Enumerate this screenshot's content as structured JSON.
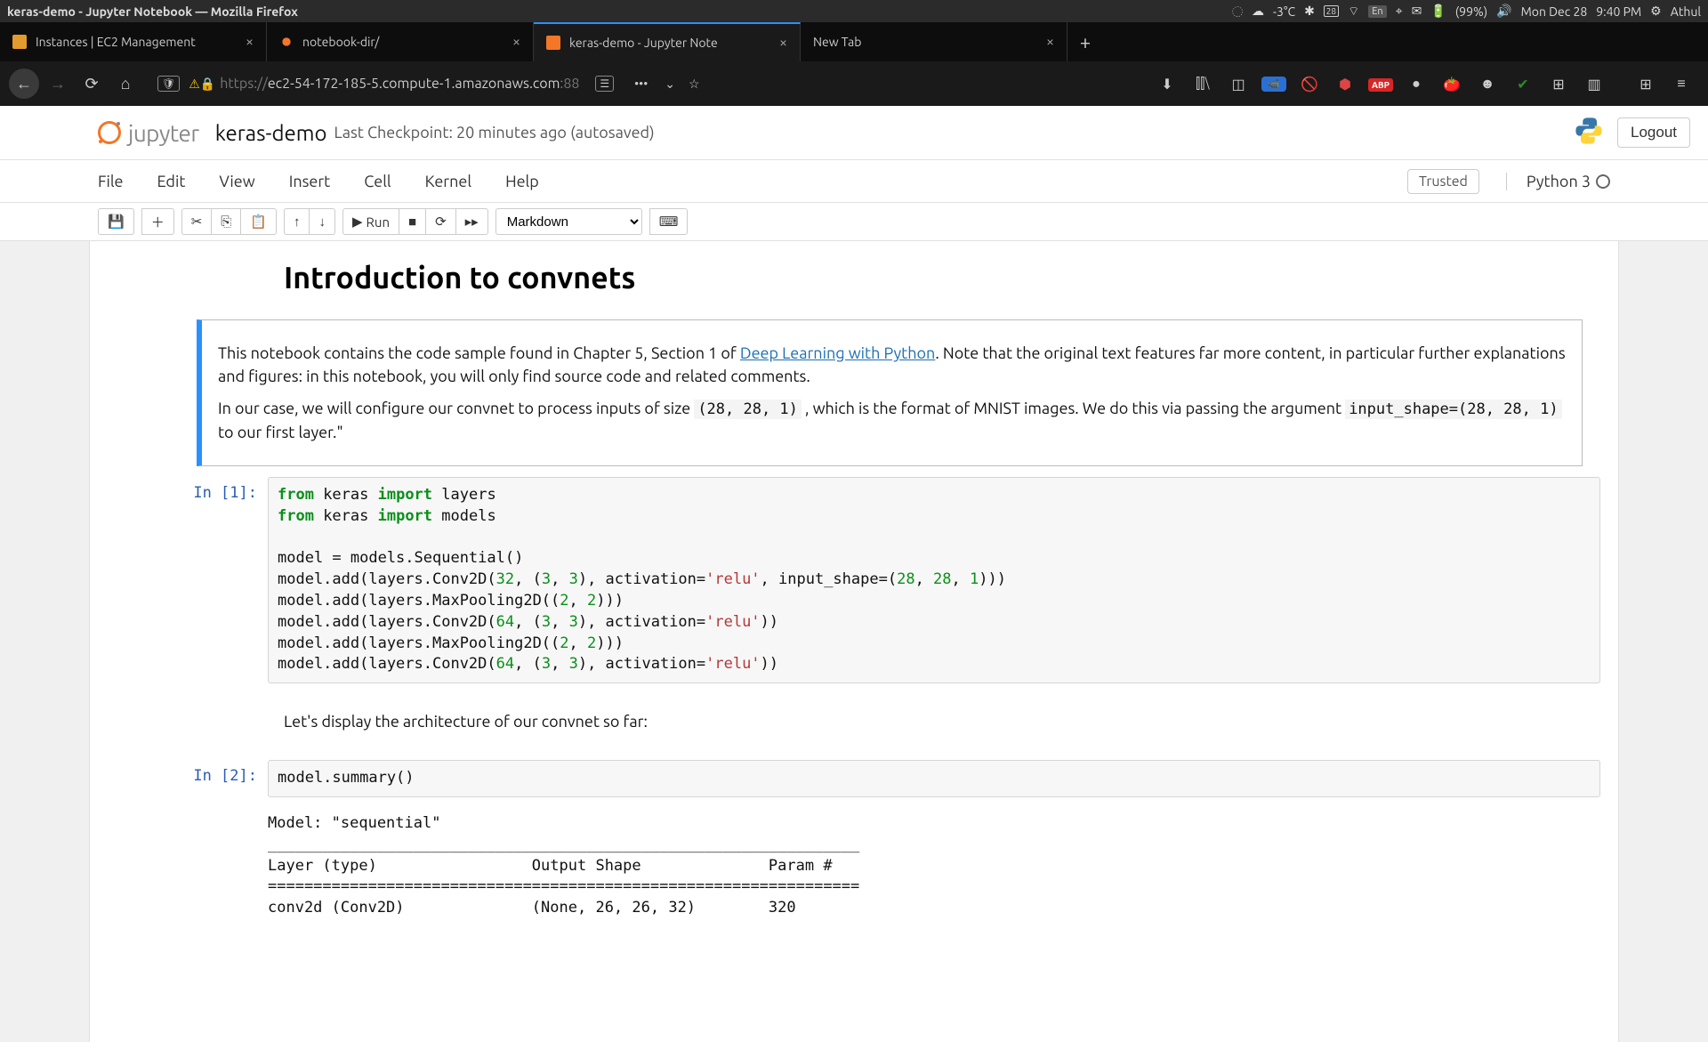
{
  "menubar": {
    "window_title": "keras-demo - Jupyter Notebook — Mozilla Firefox",
    "weather": "-3°C",
    "lang": "En",
    "battery": "(99%)",
    "day": "Mon Dec 28",
    "time": "9:40 PM",
    "user": "Athul"
  },
  "tabs": [
    {
      "label": "Instances | EC2 Management",
      "active": false,
      "color": "#e39b2d"
    },
    {
      "label": "notebook-dir/",
      "active": false,
      "color": "#f37726"
    },
    {
      "label": "keras-demo - Jupyter Note",
      "active": true,
      "color": "#f37726"
    },
    {
      "label": "New Tab",
      "active": false,
      "color": ""
    }
  ],
  "url": {
    "scheme": "https://",
    "host": "ec2-54-172-185-5.compute-1.amazonaws.com",
    "port": ":88"
  },
  "jupyter": {
    "logo": "jupyter",
    "name": "keras-demo",
    "checkpoint": "Last Checkpoint: 20 minutes ago   (autosaved)",
    "logout": "Logout",
    "menus": [
      "File",
      "Edit",
      "View",
      "Insert",
      "Cell",
      "Kernel",
      "Help"
    ],
    "trusted": "Trusted",
    "kernel": "Python 3",
    "celltype": "Markdown",
    "run_label": "Run"
  },
  "content": {
    "h2": "Introduction to convnets",
    "p1a": "This notebook contains the code sample found in Chapter 5, Section 1 of ",
    "p1link": "Deep Learning with Python",
    "p1b": ". Note that the original text features far more content, in particular further explanations and figures: in this notebook, you will only find source code and related comments.",
    "p2a": "In our case, we will configure our convnet to process inputs of size ",
    "p2code1": "(28, 28, 1)",
    "p2b": " , which is the format of MNIST images. We do this via passing the argument ",
    "p2code2": "input_shape=(28, 28, 1)",
    "p2c": " to our first layer.\"",
    "prompt1": "In [1]:",
    "prompt2": "In [2]:",
    "md2": "Let's display the architecture of our convnet so far:",
    "code2": "model.summary()",
    "out2": "Model: \"sequential\"\n_________________________________________________________________\nLayer (type)                 Output Shape              Param #   \n=================================================================\nconv2d (Conv2D)              (None, 26, 26, 32)        320       "
  }
}
